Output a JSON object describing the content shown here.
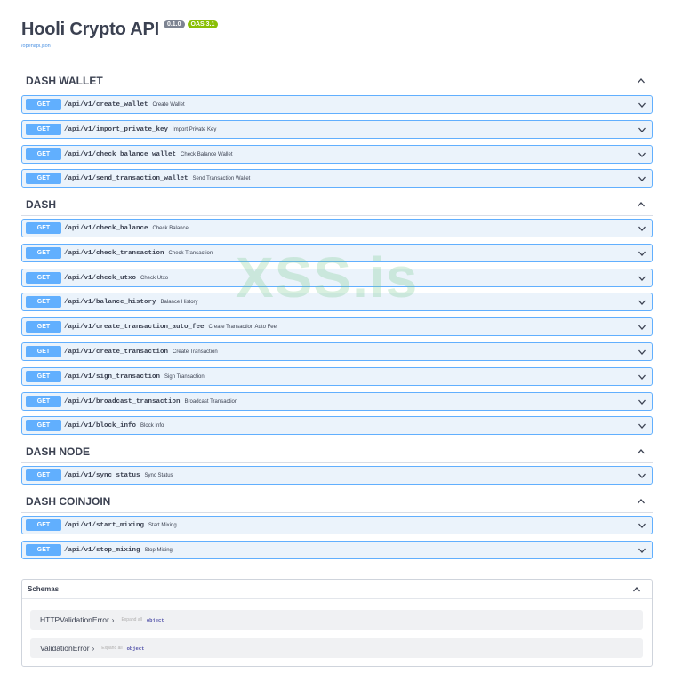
{
  "header": {
    "title": "Hooli Crypto API",
    "version_badge": "0.1.0",
    "oas_badge": "OAS 3.1",
    "spec_link": "/openapi.json"
  },
  "watermark": "XSS.is",
  "tags": [
    {
      "name": "DASH WALLET",
      "operations": [
        {
          "method": "GET",
          "path": "/api/v1/create_wallet",
          "summary": "Create Wallet"
        },
        {
          "method": "GET",
          "path": "/api/v1/import_private_key",
          "summary": "Import Private Key"
        },
        {
          "method": "GET",
          "path": "/api/v1/check_balance_wallet",
          "summary": "Check Balance Wallet"
        },
        {
          "method": "GET",
          "path": "/api/v1/send_transaction_wallet",
          "summary": "Send Transaction Wallet"
        }
      ]
    },
    {
      "name": "DASH",
      "operations": [
        {
          "method": "GET",
          "path": "/api/v1/check_balance",
          "summary": "Check Balance"
        },
        {
          "method": "GET",
          "path": "/api/v1/check_transaction",
          "summary": "Check Transaction"
        },
        {
          "method": "GET",
          "path": "/api/v1/check_utxo",
          "summary": "Check Utxo"
        },
        {
          "method": "GET",
          "path": "/api/v1/balance_history",
          "summary": "Balance History"
        },
        {
          "method": "GET",
          "path": "/api/v1/create_transaction_auto_fee",
          "summary": "Create Transaction Auto Fee"
        },
        {
          "method": "GET",
          "path": "/api/v1/create_transaction",
          "summary": "Create Transaction"
        },
        {
          "method": "GET",
          "path": "/api/v1/sign_transaction",
          "summary": "Sign Transaction"
        },
        {
          "method": "GET",
          "path": "/api/v1/broadcast_transaction",
          "summary": "Broadcast Transaction"
        },
        {
          "method": "GET",
          "path": "/api/v1/block_info",
          "summary": "Block Info"
        }
      ]
    },
    {
      "name": "DASH NODE",
      "operations": [
        {
          "method": "GET",
          "path": "/api/v1/sync_status",
          "summary": "Sync Status"
        }
      ]
    },
    {
      "name": "DASH COINJOIN",
      "operations": [
        {
          "method": "GET",
          "path": "/api/v1/start_mixing",
          "summary": "Start Mixing"
        },
        {
          "method": "GET",
          "path": "/api/v1/stop_mixing",
          "summary": "Stop Mixing"
        }
      ]
    }
  ],
  "schemas": {
    "title": "Schemas",
    "models": [
      {
        "name": "HTTPValidationError",
        "arrow": "›",
        "expand_all": "Expand all",
        "type": "object"
      },
      {
        "name": "ValidationError",
        "arrow": "›",
        "expand_all": "Expand all",
        "type": "object"
      }
    ]
  },
  "colors": {
    "get_method": "#61affe",
    "get_background": "#ebf3fb",
    "oas_badge": "#89bf04",
    "version_badge": "#7d8492"
  },
  "icons": {
    "collapse": "chevron-up-icon",
    "expand": "chevron-down-icon"
  }
}
